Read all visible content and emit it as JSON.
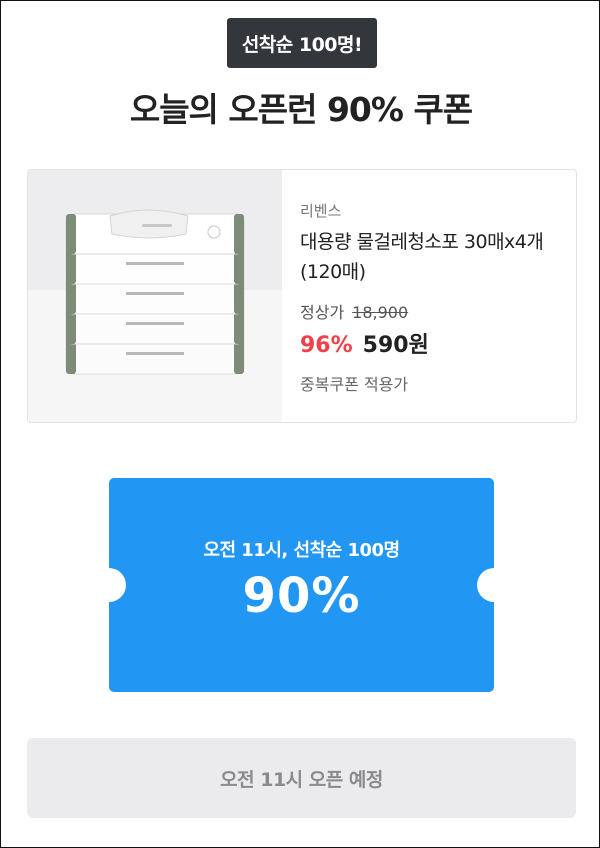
{
  "badge": {
    "label": "선착순 100명!"
  },
  "headline": "오늘의 오픈런 90% 쿠폰",
  "product": {
    "brand": "리벤스",
    "name": "대용량 물걸레청소포 30매x4개 (120매)",
    "regular_price_label": "정상가",
    "regular_price": "18,900",
    "discount_percent": "96%",
    "sale_price": "590원",
    "coupon_note": "중복쿠폰 적용가",
    "image_icon": "wipes-pack-image"
  },
  "coupon": {
    "subtitle": "오전 11시, 선착순 100명",
    "discount": "90%",
    "color": "#2196f3"
  },
  "action": {
    "label": "오전 11시 오픈 예정",
    "color": "#ebebed"
  }
}
